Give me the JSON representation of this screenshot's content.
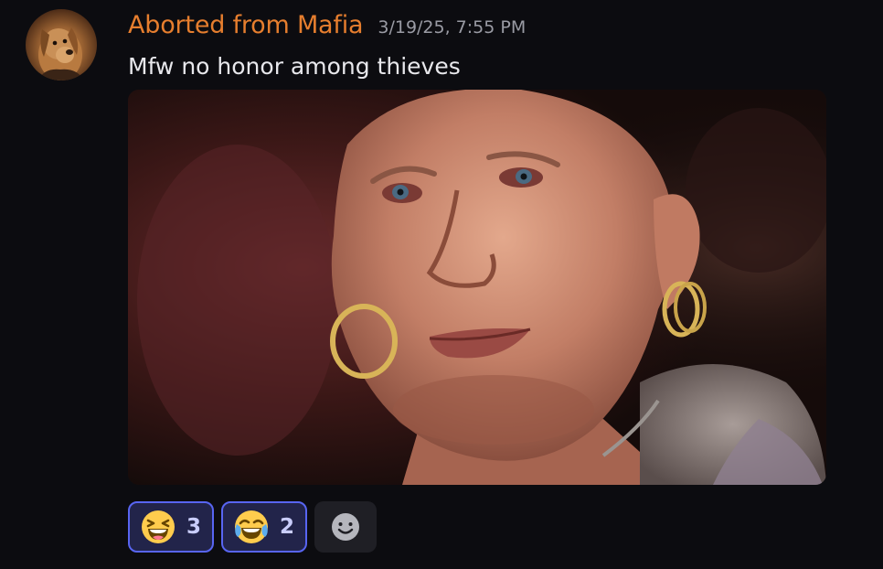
{
  "message": {
    "author": "Aborted from Mafia",
    "timestamp": "3/19/25, 7:55 PM",
    "text": "Mfw no honor among thieves",
    "author_color": "#e67e2e",
    "avatar_icon": "dog-avatar",
    "attachment": {
      "kind": "image",
      "alt": "Mfw no honor among thieves"
    }
  },
  "reactions": [
    {
      "emoji": "laughing",
      "count": "3",
      "reacted_by_me": true
    },
    {
      "emoji": "joy",
      "count": "2",
      "reacted_by_me": true
    }
  ],
  "add_reaction": {
    "icon": "add-reaction-smiley-icon"
  },
  "colors": {
    "background": "#0c0c10",
    "reaction_border": "#5865f2",
    "reaction_bg": "#22244a"
  }
}
